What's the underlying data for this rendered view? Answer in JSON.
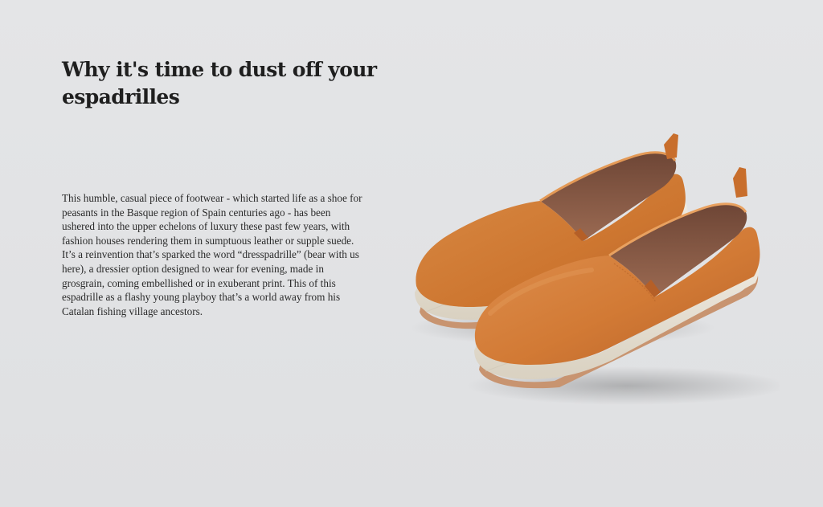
{
  "article": {
    "headline": "Why it's time to dust off your espadrilles",
    "body": "This humble, casual piece of footwear - which started life as a shoe for peasants in the Basque region of Spain centuries ago - has been ushered into the upper echelons of luxury these past few years, with fashion houses rendering them in sumptuous leather or supple suede. It’s a reinvention that’s sparked the word “dresspadrille” (bear with us here), a dressier option designed to wear for evening, made in grosgrain, coming embellished or in exuberant print. This of this espadrille as a flashy young playboy that’s a world away from his Catalan fishing village ancestors."
  },
  "image": {
    "subject": "pair of tan suede espadrilles",
    "colors": {
      "background": "#e1e2e4",
      "suede": "#d07a34",
      "suede_shadow": "#b4612a",
      "lining": "#8a5a45",
      "jute": "#e7e1d4",
      "sole": "#c8916a"
    }
  }
}
